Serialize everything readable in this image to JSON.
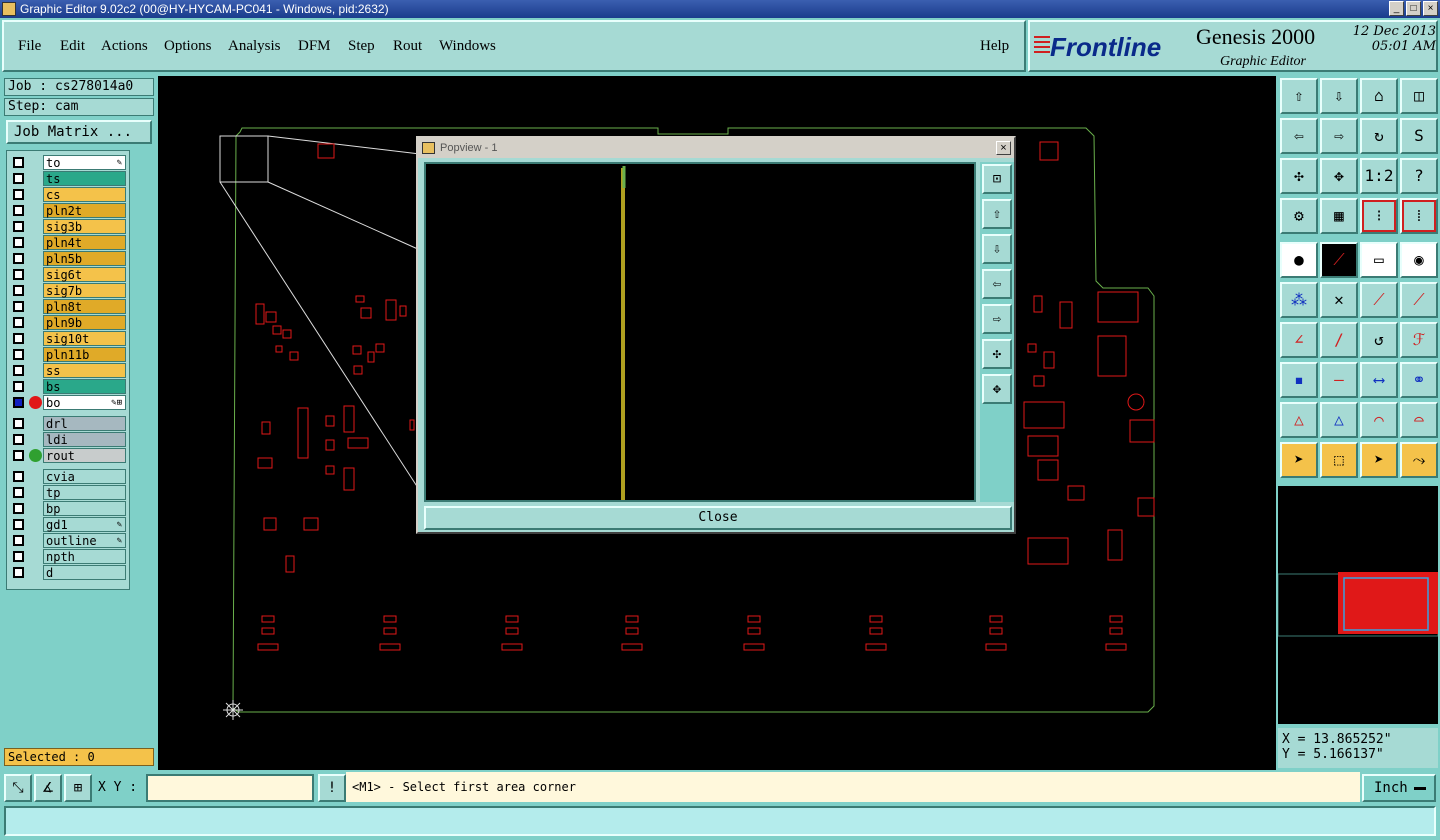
{
  "window": {
    "title": "Graphic Editor 9.02c2 (00@HY-HYCAM-PC041 - Windows, pid:2632)",
    "controls": [
      "_",
      "□",
      "×"
    ]
  },
  "menu": [
    "File",
    "Edit",
    "Actions",
    "Options",
    "Analysis",
    "DFM",
    "Step",
    "Rout",
    "Windows"
  ],
  "help_label": "Help",
  "brand": {
    "logo": "Frontline",
    "product": "Genesis 2000",
    "subtitle": "Graphic Editor",
    "date": "12 Dec 2013",
    "time": "05:01 AM"
  },
  "job": {
    "job_label": "Job : cs278014a0",
    "step_label": "Step: cam",
    "matrix_button": "Job Matrix ..."
  },
  "layers": [
    {
      "name": "to",
      "color": "#ffffff",
      "flag": "✎"
    },
    {
      "name": "ts",
      "color": "#2aa88a",
      "flag": ""
    },
    {
      "name": "cs",
      "color": "#f4c24a",
      "flag": ""
    },
    {
      "name": "pln2t",
      "color": "#e0aa28",
      "flag": ""
    },
    {
      "name": "sig3b",
      "color": "#f4c24a",
      "flag": ""
    },
    {
      "name": "pln4t",
      "color": "#e0aa28",
      "flag": ""
    },
    {
      "name": "pln5b",
      "color": "#e0aa28",
      "flag": ""
    },
    {
      "name": "sig6t",
      "color": "#f4c24a",
      "flag": ""
    },
    {
      "name": "sig7b",
      "color": "#f4c24a",
      "flag": ""
    },
    {
      "name": "pln8t",
      "color": "#e0aa28",
      "flag": ""
    },
    {
      "name": "pln9b",
      "color": "#e0aa28",
      "flag": ""
    },
    {
      "name": "sig10t",
      "color": "#f4c24a",
      "flag": ""
    },
    {
      "name": "pln11b",
      "color": "#e0aa28",
      "flag": ""
    },
    {
      "name": "ss",
      "color": "#f4c24a",
      "flag": ""
    },
    {
      "name": "bs",
      "color": "#2aa88a",
      "flag": ""
    },
    {
      "name": "bo",
      "color": "#ffffff",
      "flag": "✎⊞"
    },
    {
      "name": "drl",
      "color": "#a6b8c0",
      "flag": ""
    },
    {
      "name": "ldi",
      "color": "#a6b8c0",
      "flag": ""
    },
    {
      "name": "rout",
      "color": "#c8cccc",
      "flag": ""
    },
    {
      "name": "cvia",
      "color": "#a6dad4",
      "flag": ""
    },
    {
      "name": "tp",
      "color": "#a6dad4",
      "flag": ""
    },
    {
      "name": "bp",
      "color": "#a6dad4",
      "flag": ""
    },
    {
      "name": "gd1",
      "color": "#a6dad4",
      "flag": "✎"
    },
    {
      "name": "outline",
      "color": "#a6dad4",
      "flag": "✎"
    },
    {
      "name": "npth",
      "color": "#a6dad4",
      "flag": ""
    },
    {
      "name": "d",
      "color": "#a6dad4",
      "flag": ""
    }
  ],
  "selected_label": "Selected : 0",
  "popview": {
    "title": "Popview - 1",
    "close_label": "Close",
    "close_icon": "×"
  },
  "coords": {
    "x": "X = 13.865252\"",
    "y": "Y = 5.166137\""
  },
  "bottom": {
    "xy_label": "X Y :",
    "xy_value": "",
    "prompt": "<M1> - Select first area corner",
    "units": "Inch"
  },
  "colors": {
    "board_outline": "#6ab04c",
    "features": "#e01818",
    "trace": "#b0a020"
  }
}
